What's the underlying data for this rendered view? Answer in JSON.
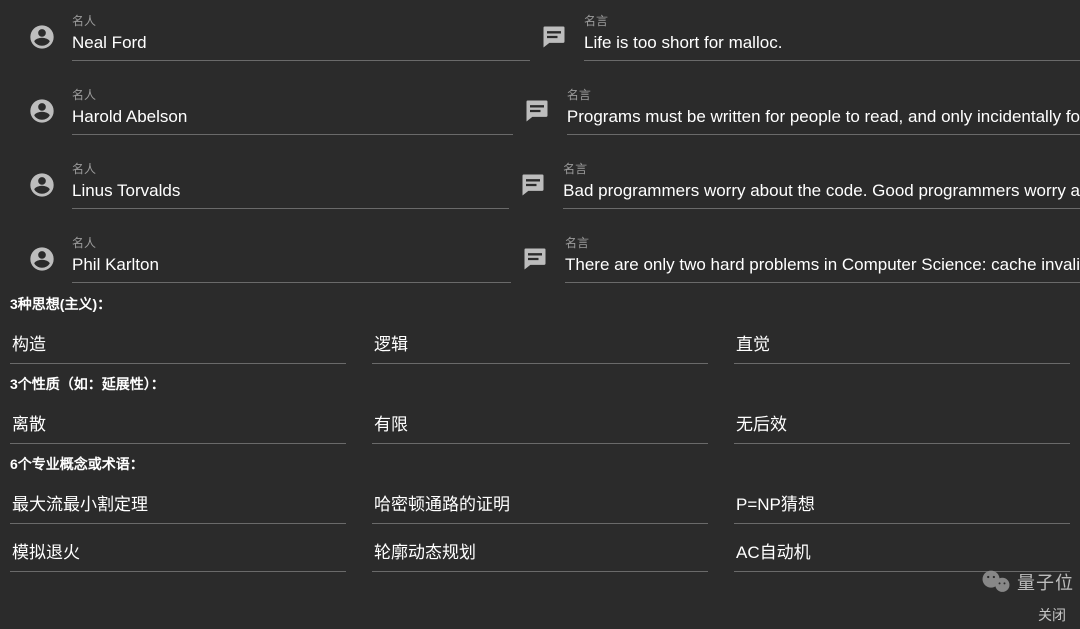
{
  "labels": {
    "person": "名人",
    "quote": "名言"
  },
  "rows": [
    {
      "name": "Neal Ford",
      "quote": "Life is too short for malloc."
    },
    {
      "name": "Harold Abelson",
      "quote": "Programs must be written for people to read, and only incidentally fo"
    },
    {
      "name": "Linus Torvalds",
      "quote": "Bad programmers worry about the code. Good programmers worry a"
    },
    {
      "name": "Phil Karlton",
      "quote": "There are only two hard problems in Computer Science: cache invali"
    }
  ],
  "sections": {
    "ideologies": {
      "title": "3种思想(主义)：",
      "items": [
        "构造",
        "逻辑",
        "直觉"
      ]
    },
    "properties": {
      "title": "3个性质（如：延展性）：",
      "items": [
        "离散",
        "有限",
        "无后效"
      ]
    },
    "concepts": {
      "title": "6个专业概念或术语：",
      "items": [
        "最大流最小割定理",
        "哈密顿通路的证明",
        "P=NP猜想",
        "模拟退火",
        "轮廓动态规划",
        "AC自动机"
      ]
    }
  },
  "watermark": {
    "text": "量子位"
  },
  "footer": {
    "close": "关闭"
  }
}
